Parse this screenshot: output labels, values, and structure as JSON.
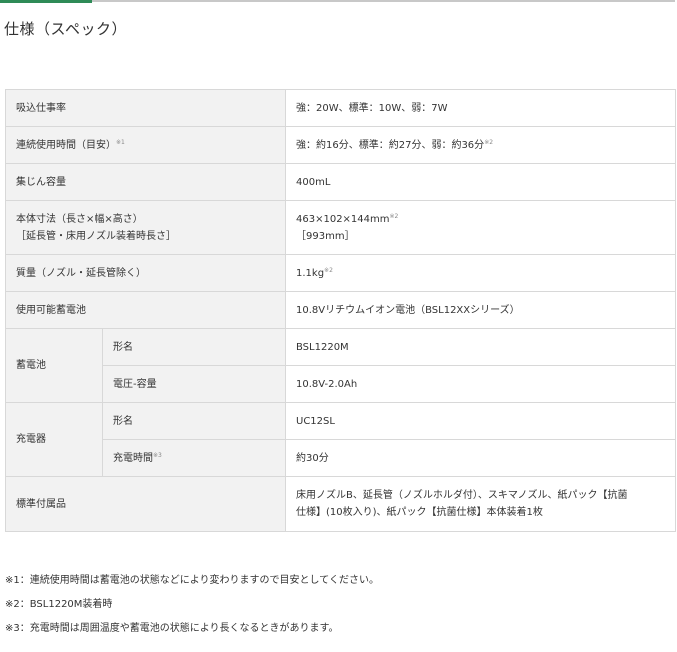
{
  "page_title": "仕様（スペック）",
  "colors": {
    "accent": "#2e8b57",
    "label_bg": "#f2f2f2",
    "border": "#d8d8d8"
  },
  "spec_table": {
    "suction_power": {
      "label": "吸込仕事率",
      "value": "強：20W、標準：10W、弱：7W"
    },
    "runtime": {
      "label": "連続使用時間（目安）",
      "label_note": "※1",
      "value": "強：約16分、標準：約27分、弱：約36分",
      "value_note": "※2"
    },
    "dust_capacity": {
      "label": "集じん容量",
      "value": "400mL"
    },
    "dimensions": {
      "label_line1": "本体寸法（長さ×幅×高さ）",
      "label_line2": "［延長管・床用ノズル装着時長さ］",
      "value_line1": "463×102×144mm",
      "value_note": "※2",
      "value_line2": "［993mm］"
    },
    "weight": {
      "label": "質量（ノズル・延長管除く）",
      "value": "1.1kg",
      "value_note": "※2"
    },
    "battery_compat": {
      "label": "使用可能蓄電池",
      "value": "10.8Vリチウムイオン電池（BSL12XXシリーズ）"
    },
    "battery": {
      "label": "蓄電池",
      "model": {
        "label": "形名",
        "value": "BSL1220M"
      },
      "voltage": {
        "label": "電圧-容量",
        "value": "10.8V-2.0Ah"
      }
    },
    "charger": {
      "label": "充電器",
      "model": {
        "label": "形名",
        "value": "UC12SL"
      },
      "charge_time": {
        "label": "充電時間",
        "label_note": "※3",
        "value": "約30分"
      }
    },
    "accessories": {
      "label": "標準付属品",
      "value_line1": "床用ノズルB、延長管（ノズルホルダ付）、スキマノズル、紙パック【抗菌",
      "value_line2": "仕様】(10枚入り)、紙パック【抗菌仕様】本体装着1枚"
    }
  },
  "notes": [
    "※1：連続使用時間は蓄電池の状態などにより変わりますので目安としてください。",
    "※2：BSL1220M装着時",
    "※3：充電時間は周囲温度や蓄電池の状態により長くなるときがあります。"
  ]
}
